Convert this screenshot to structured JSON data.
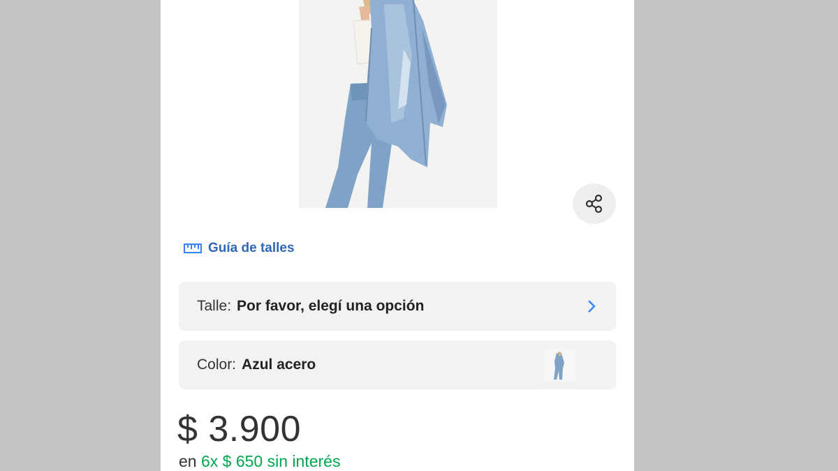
{
  "product": {
    "image_alt": "Modelo con campera y jean azul",
    "share_icon": "share-icon"
  },
  "size_guide": {
    "label": "Guía de talles",
    "icon": "ruler-icon"
  },
  "options": {
    "size": {
      "label": "Talle:",
      "value": "Por favor, elegí una opción"
    },
    "color": {
      "label": "Color:",
      "value": "Azul acero"
    }
  },
  "price": {
    "amount": "$ 3.900",
    "installments_prefix": "en",
    "installments_count": "6x",
    "installments_amount": "$ 650",
    "installments_suffix": "sin interés"
  },
  "colors": {
    "accent": "#3483fa",
    "green": "#00a650",
    "background": "#c4c4c4"
  }
}
